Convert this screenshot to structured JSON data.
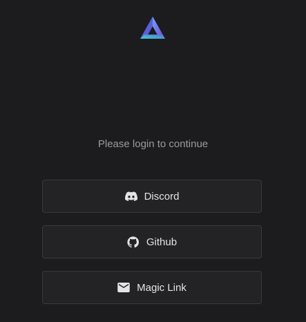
{
  "login": {
    "prompt": "Please login to continue",
    "buttons": [
      {
        "label": "Discord",
        "icon": "discord-icon"
      },
      {
        "label": "Github",
        "icon": "github-icon"
      },
      {
        "label": "Magic Link",
        "icon": "mail-icon"
      }
    ]
  },
  "logo": {
    "icon": "triangle-logo",
    "colors": [
      "#5a7be6",
      "#7a3fd0",
      "#3fd0c8"
    ]
  },
  "theme": {
    "background": "#1c1c1e",
    "button_background": "#232325",
    "button_border": "#3a3a3d",
    "text_color": "#e4e4e7",
    "muted_text": "#9a9aa0"
  }
}
